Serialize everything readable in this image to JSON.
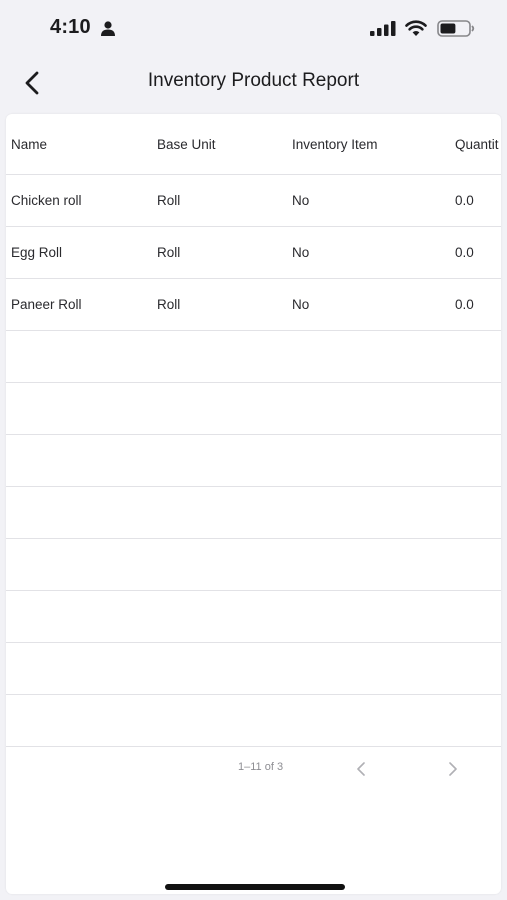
{
  "status": {
    "time": "4:10",
    "icons": [
      "person-icon",
      "signal-icon",
      "wifi-icon",
      "battery-icon"
    ],
    "battery_level": 0.55
  },
  "nav": {
    "back_icon": "chevron-left-icon",
    "title": "Inventory Product Report"
  },
  "table": {
    "columns": [
      "Name",
      "Base Unit",
      "Inventory Item",
      "Quantit"
    ],
    "rows": [
      [
        "Chicken roll",
        "Roll",
        "No",
        "0.0"
      ],
      [
        "Egg Roll",
        "Roll",
        "No",
        "0.0"
      ],
      [
        "Paneer Roll",
        "Roll",
        "No",
        "0.0"
      ]
    ]
  },
  "pagination": {
    "range": "1–11 of 3",
    "prev_icon": "chevron-left-icon",
    "next_icon": "chevron-right-icon"
  },
  "colors": {
    "background": "#f2f2f6",
    "card": "#ffffff",
    "divider": "#e2e2e6",
    "muted": "#8e8e93"
  }
}
